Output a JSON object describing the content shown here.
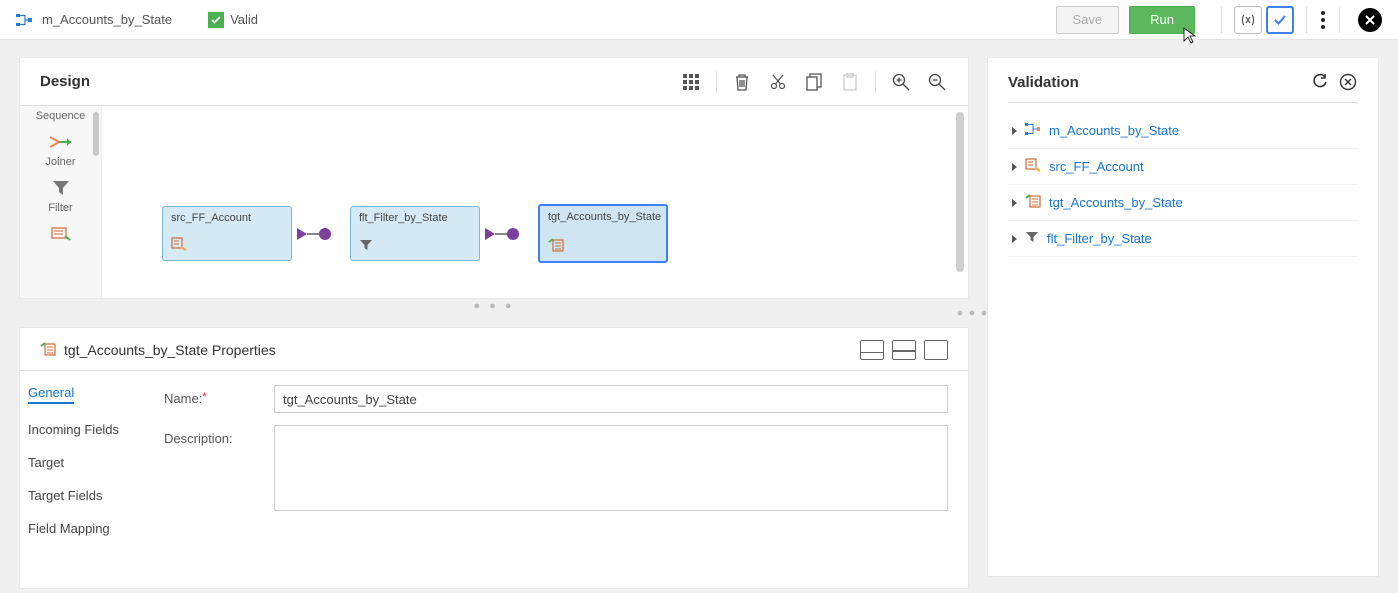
{
  "header": {
    "title": "m_Accounts_by_State",
    "valid_label": "Valid",
    "save_label": "Save",
    "run_label": "Run"
  },
  "design": {
    "title": "Design",
    "palette": {
      "sequence": "Sequence",
      "joiner": "Joiner",
      "filter": "Filter"
    },
    "nodes": {
      "src": "src_FF_Account",
      "flt": "flt_Filter_by_State",
      "tgt": "tgt_Accounts_by_State"
    }
  },
  "properties": {
    "heading_suffix": "Properties",
    "tabs": {
      "general": "General",
      "incoming": "Incoming Fields",
      "target": "Target",
      "target_fields": "Target Fields",
      "field_mapping": "Field Mapping"
    },
    "form": {
      "name_label": "Name:",
      "name_value": "tgt_Accounts_by_State",
      "desc_label": "Description:",
      "desc_value": ""
    }
  },
  "validation": {
    "title": "Validation",
    "items": [
      {
        "label": "m_Accounts_by_State",
        "icon": "mapping"
      },
      {
        "label": "src_FF_Account",
        "icon": "source"
      },
      {
        "label": "tgt_Accounts_by_State",
        "icon": "target"
      },
      {
        "label": "flt_Filter_by_State",
        "icon": "filter"
      }
    ]
  }
}
